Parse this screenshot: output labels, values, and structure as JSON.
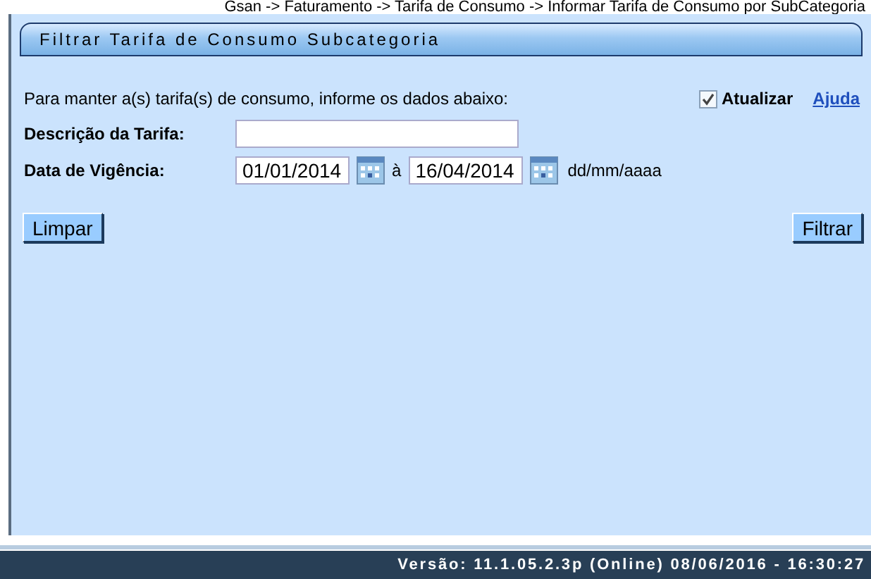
{
  "breadcrumb": "Gsan -> Faturamento -> Tarifa de Consumo -> Informar Tarifa de Consumo por SubCategoria",
  "title": "Filtrar Tarifa de Consumo Subcategoria",
  "instructions": "Para manter a(s) tarifa(s) de consumo, informe os dados abaixo:",
  "atualizar": {
    "label": "Atualizar",
    "checked": true
  },
  "help_link": "Ajuda",
  "descricao": {
    "label": "Descrição da Tarifa:"
  },
  "vigencia": {
    "label": "Data de Vigência:",
    "start": "01/01/2014",
    "separator": "à",
    "end": "16/04/2014",
    "format": "dd/mm/aaaa"
  },
  "buttons": [
    {
      "label": "Limpar"
    },
    {
      "label": "Filtrar"
    }
  ],
  "status_bar": "Versão: 11.1.05.2.3p (Online) 08/06/2016 - 16:30:27"
}
